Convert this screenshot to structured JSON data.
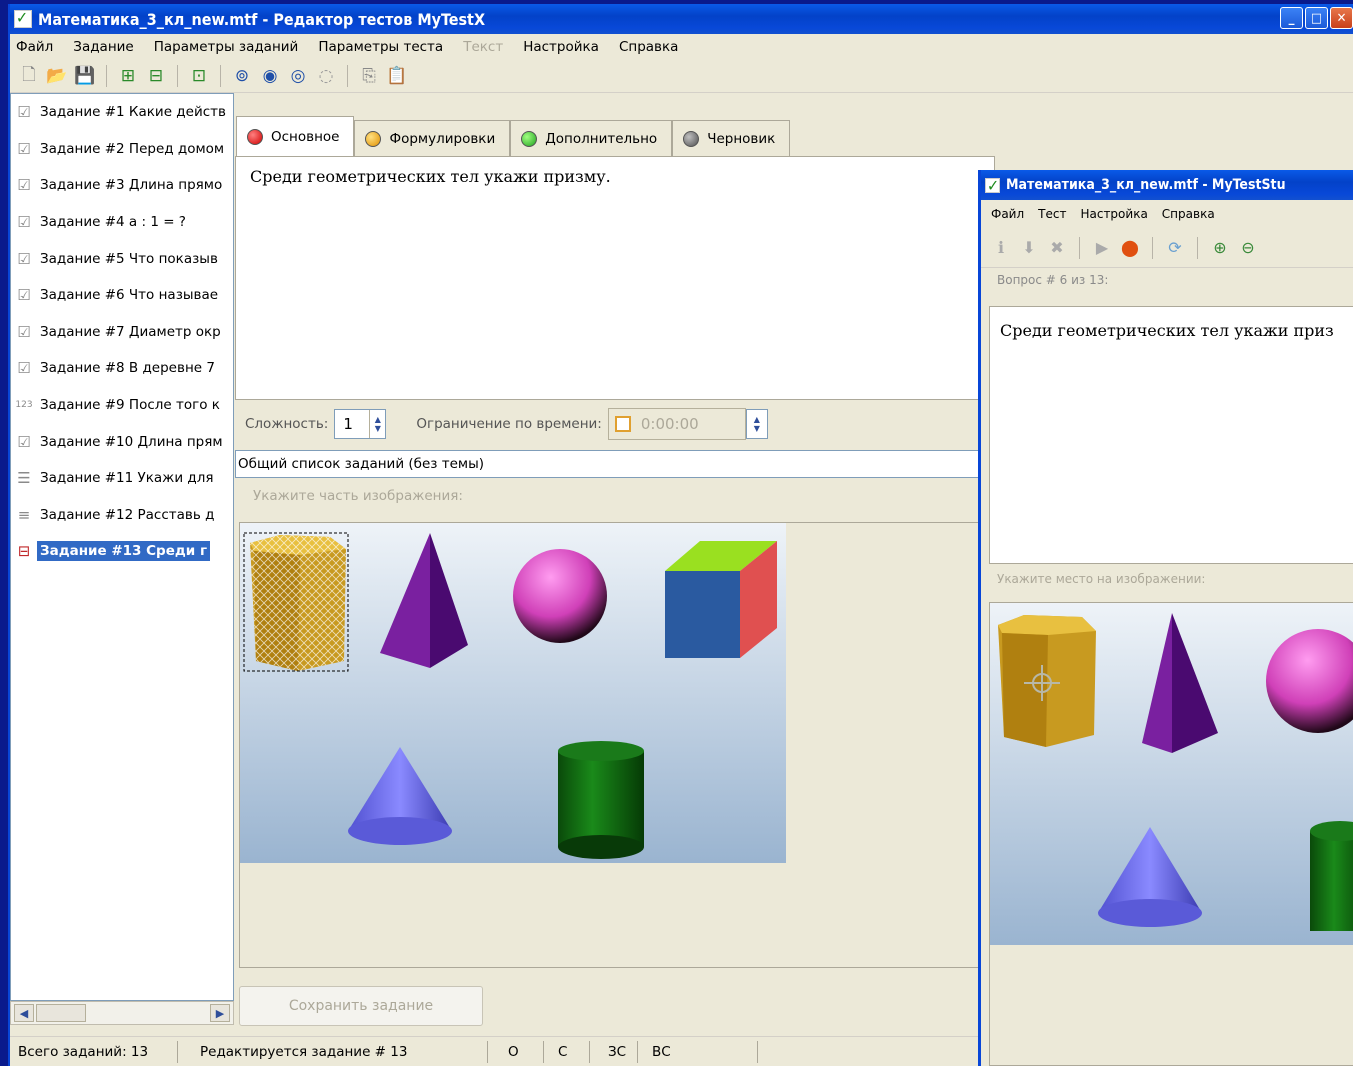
{
  "editor": {
    "title": "Математика_3_кл_new.mtf - Редактор тестов MyTestX",
    "menu": [
      "Файл",
      "Задание",
      "Параметры заданий",
      "Параметры теста",
      "Текст",
      "Настройка",
      "Справка"
    ],
    "tasks": [
      "Задание #1 Какие действ",
      "Задание #2 Перед домом",
      "Задание #3 Длина прямо",
      "Задание #4 a : 1 = ?",
      "Задание #5 Что показыв",
      "Задание #6 Что называе",
      "Задание #7 Диаметр окр",
      "Задание #8 В деревне 7",
      "Задание #9 После того к",
      "Задание #10 Длина прям",
      "Задание #11 Укажи для",
      "Задание #12 Расставь д",
      "Задание #13 Среди г"
    ],
    "tabs": [
      "Основное",
      "Формулировки",
      "Дополнительно",
      "Черновик"
    ],
    "question_text": "Среди геометрических тел укажи призму.",
    "difficulty_label": "Сложность:",
    "difficulty_value": "1",
    "time_limit_label": "Ограничение по времени:",
    "time_limit_value": "0:00:00",
    "theme": "Общий список заданий (без темы)",
    "hint": "Укажите часть изображения:",
    "save_button": "Сохранить задание",
    "status": {
      "total": "Всего заданий: 13",
      "editing": "Редактируется задание # 13",
      "cells": [
        "О",
        "С",
        "ЗС",
        "ВС"
      ]
    }
  },
  "student": {
    "title": "Математика_3_кл_new.mtf - MyTestStu",
    "menu": [
      "Файл",
      "Тест",
      "Настройка",
      "Справка"
    ],
    "question_number": "Вопрос # 6 из 13:",
    "question_text": "Среди геометрических тел укажи приз",
    "hint": "Укажите место на изображении:"
  },
  "colors": {
    "desktop": "#0a1a8c",
    "titlebar": "#0342c8",
    "selection": "#316ac5",
    "window_bg": "#ece9d8"
  }
}
